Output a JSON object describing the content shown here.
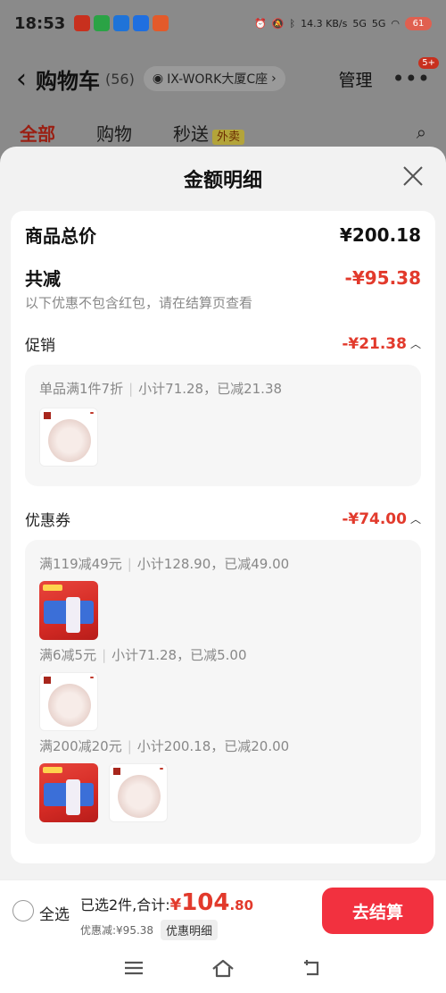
{
  "status": {
    "time": "18:53",
    "network_speed": "14.3 KB/s",
    "signal1": "5G",
    "signal2": "5G",
    "battery": "61"
  },
  "header": {
    "title": "购物车",
    "count": "(56)",
    "address": "IX-WORK大厦C座",
    "manage": "管理",
    "badge": "5+"
  },
  "tabs": [
    {
      "label": "全部"
    },
    {
      "label": "购物"
    },
    {
      "label": "秒送",
      "badge": "外卖"
    }
  ],
  "sheet": {
    "title": "金额明细",
    "total_label": "商品总价",
    "total_value": "¥200.18",
    "discount_label": "共减",
    "discount_value": "-¥95.38",
    "discount_note": "以下优惠不包含红包，请在结算页查看",
    "promo": {
      "label": "促销",
      "value": "-¥21.38",
      "rule": "单品满1件7折",
      "detail": "小计71.28，已减21.38"
    },
    "coupon": {
      "label": "优惠券",
      "value": "-¥74.00",
      "groups": [
        {
          "rule": "满119减49元",
          "detail": "小计128.90，已减49.00"
        },
        {
          "rule": "满6减5元",
          "detail": "小计71.28，已减5.00"
        },
        {
          "rule": "满200减20元",
          "detail": "小计200.18，已减20.00"
        }
      ]
    }
  },
  "checkout": {
    "select_all": "全选",
    "selected_text": "已选2件,合计:",
    "currency": "¥",
    "amount_int": "104",
    "amount_dec": ".80",
    "discount_text": "优惠减:¥95.38",
    "detail_chip": "优惠明细",
    "pay_button": "去结算"
  },
  "colors": {
    "accent_red": "#e23a2c",
    "pay_button": "#f2313f"
  }
}
